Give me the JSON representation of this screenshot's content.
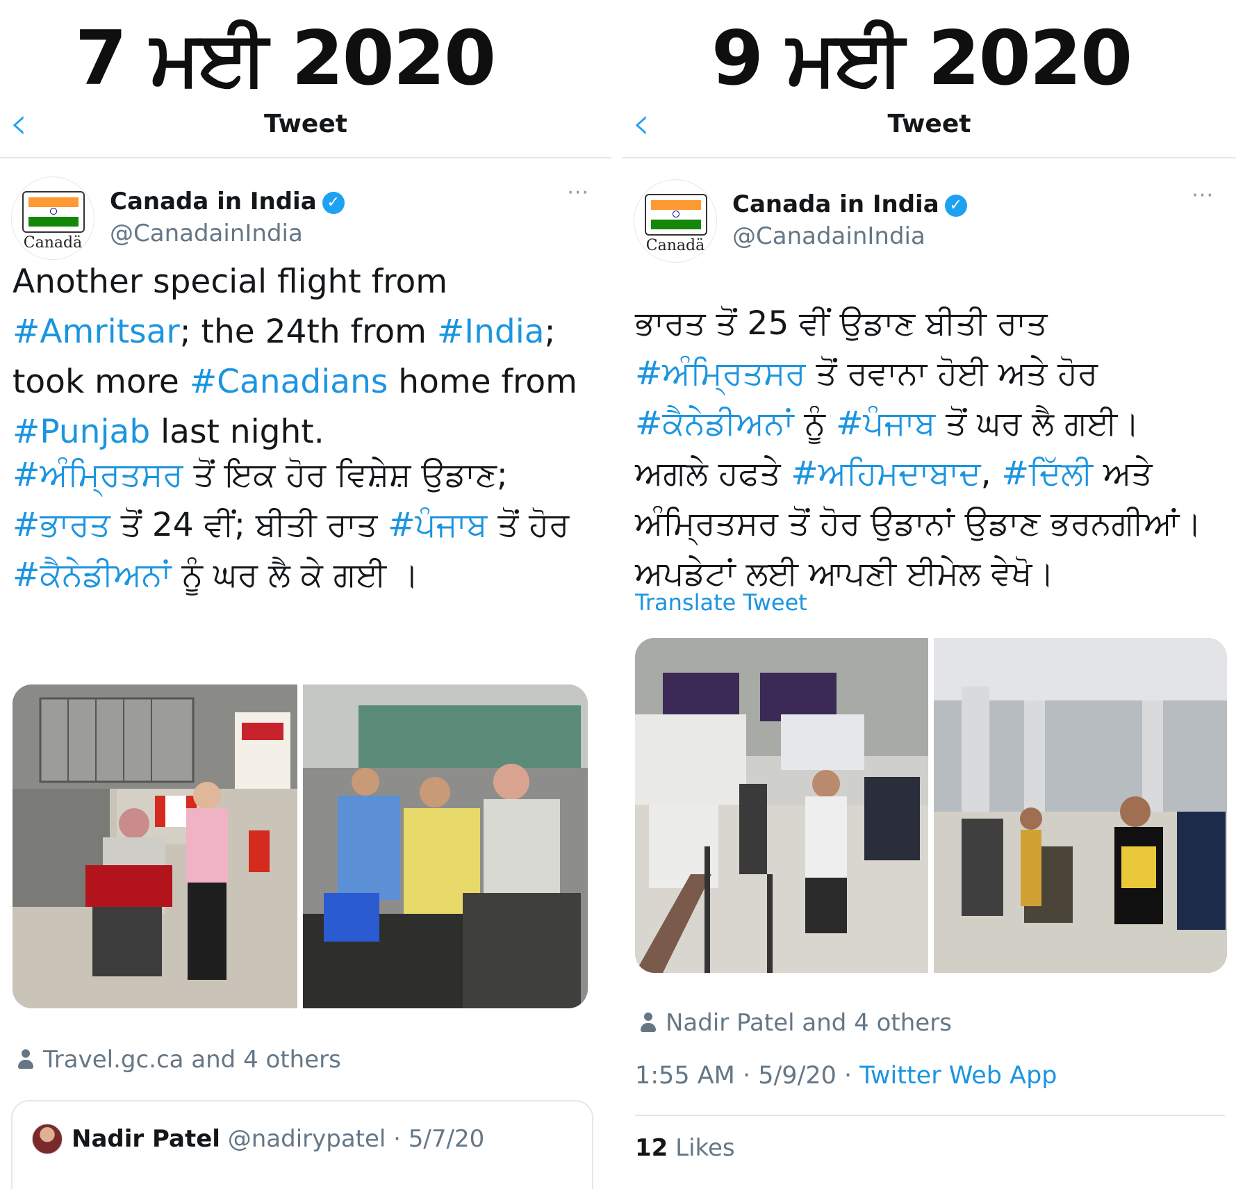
{
  "left_panel": {
    "date_label": "7 ਮਈ 2020",
    "nav": {
      "back_icon": "‹",
      "title": "Tweet"
    },
    "account": {
      "name": "Canada in India",
      "handle": "@CanadainIndia",
      "avatar_text": "Canadä"
    },
    "more_label": "···",
    "english_text": [
      {
        "t": "Another special flight from ",
        "h": false
      },
      {
        "t": "#Amritsar",
        "h": true
      },
      {
        "t": "; the 24th from ",
        "h": false
      },
      {
        "t": "#India",
        "h": true
      },
      {
        "t": "; took more ",
        "h": false
      },
      {
        "t": "#Canadians",
        "h": true
      },
      {
        "t": " home from ",
        "h": false
      },
      {
        "t": "#Punjab",
        "h": true
      },
      {
        "t": " last night.",
        "h": false
      }
    ],
    "punjabi_text": [
      {
        "t": "#ਅੰਮ੍ਰਿਤਸਰ",
        "h": true
      },
      {
        "t": " ਤੋਂ ਇਕ ਹੋਰ ਵਿਸ਼ੇਸ਼ ਉਡਾਣ; ",
        "h": false
      },
      {
        "t": "#ਭਾਰਤ",
        "h": true
      },
      {
        "t": " ਤੋਂ 24 ਵੀਂ; ਬੀਤੀ ਰਾਤ ",
        "h": false
      },
      {
        "t": "#ਪੰਜਾਬ",
        "h": true
      },
      {
        "t": " ਤੋਂ ਹੋਰ ",
        "h": false
      },
      {
        "t": "#ਕੈਨੇਡੀਅਨਾਂ",
        "h": true
      },
      {
        "t": " ਨੂੰ ਘਰ ਲੈ ਕੇ ਗਈ ।",
        "h": false
      }
    ],
    "tagged_people": "Travel.gc.ca and 4 others",
    "quoted_tweet": {
      "name": "Nadir Patel",
      "handle": "@nadirypatel",
      "date": "5/7/20"
    }
  },
  "right_panel": {
    "date_label": "9 ਮਈ 2020",
    "nav": {
      "back_icon": "‹",
      "title": "Tweet"
    },
    "account": {
      "name": "Canada in India",
      "handle": "@CanadainIndia",
      "avatar_text": "Canadä"
    },
    "more_label": "···",
    "punjabi_text": [
      {
        "t": "ਭਾਰਤ ਤੋਂ 25 ਵੀਂ ਉਡਾਣ ਬੀਤੀ ਰਾਤ ",
        "h": false
      },
      {
        "t": "#ਅੰਮ੍ਰਿਤਸਰ",
        "h": true
      },
      {
        "t": " ਤੋਂ ਰਵਾਨਾ ਹੋਈ ਅਤੇ ਹੋਰ ",
        "h": false
      },
      {
        "t": "#ਕੈਨੇਡੀਅਨਾਂ",
        "h": true
      },
      {
        "t": " ਨੂੰ ",
        "h": false
      },
      {
        "t": "#ਪੰਜਾਬ",
        "h": true
      },
      {
        "t": " ਤੋਂ ਘਰ ਲੈ ਗਈ। ਅਗਲੇ ਹਫਤੇ ",
        "h": false
      },
      {
        "t": "#ਅਹਿਮਦਾਬਾਦ",
        "h": true
      },
      {
        "t": ", ",
        "h": false
      },
      {
        "t": "#ਦਿੱਲੀ",
        "h": true
      },
      {
        "t": " ਅਤੇ ਅੰਮ੍ਰਿਤਸਰ ਤੋਂ ਹੋਰ ਉਡਾਨਾਂ ਉਡਾਣ ਭਰਨਗੀਆਂ। ਅਪਡੇਟਾਂ ਲਈ ਆਪਣੀ ਈਮੇਲ ਵੇਖੋ।",
        "h": false
      }
    ],
    "translate_label": "Translate Tweet",
    "tagged_people": "Nadir Patel and 4 others",
    "time": "1:55 AM · 5/9/20 · ",
    "source": "Twitter Web App",
    "likes_count": "12",
    "likes_label": " Likes"
  },
  "icons": {
    "back": "chevron-left-icon",
    "verified": "verified-badge-icon",
    "more": "more-dots-icon",
    "person": "person-icon"
  },
  "colors": {
    "link": "#1b95e0",
    "secondary_text": "#657786",
    "verified": "#1da1f2"
  }
}
